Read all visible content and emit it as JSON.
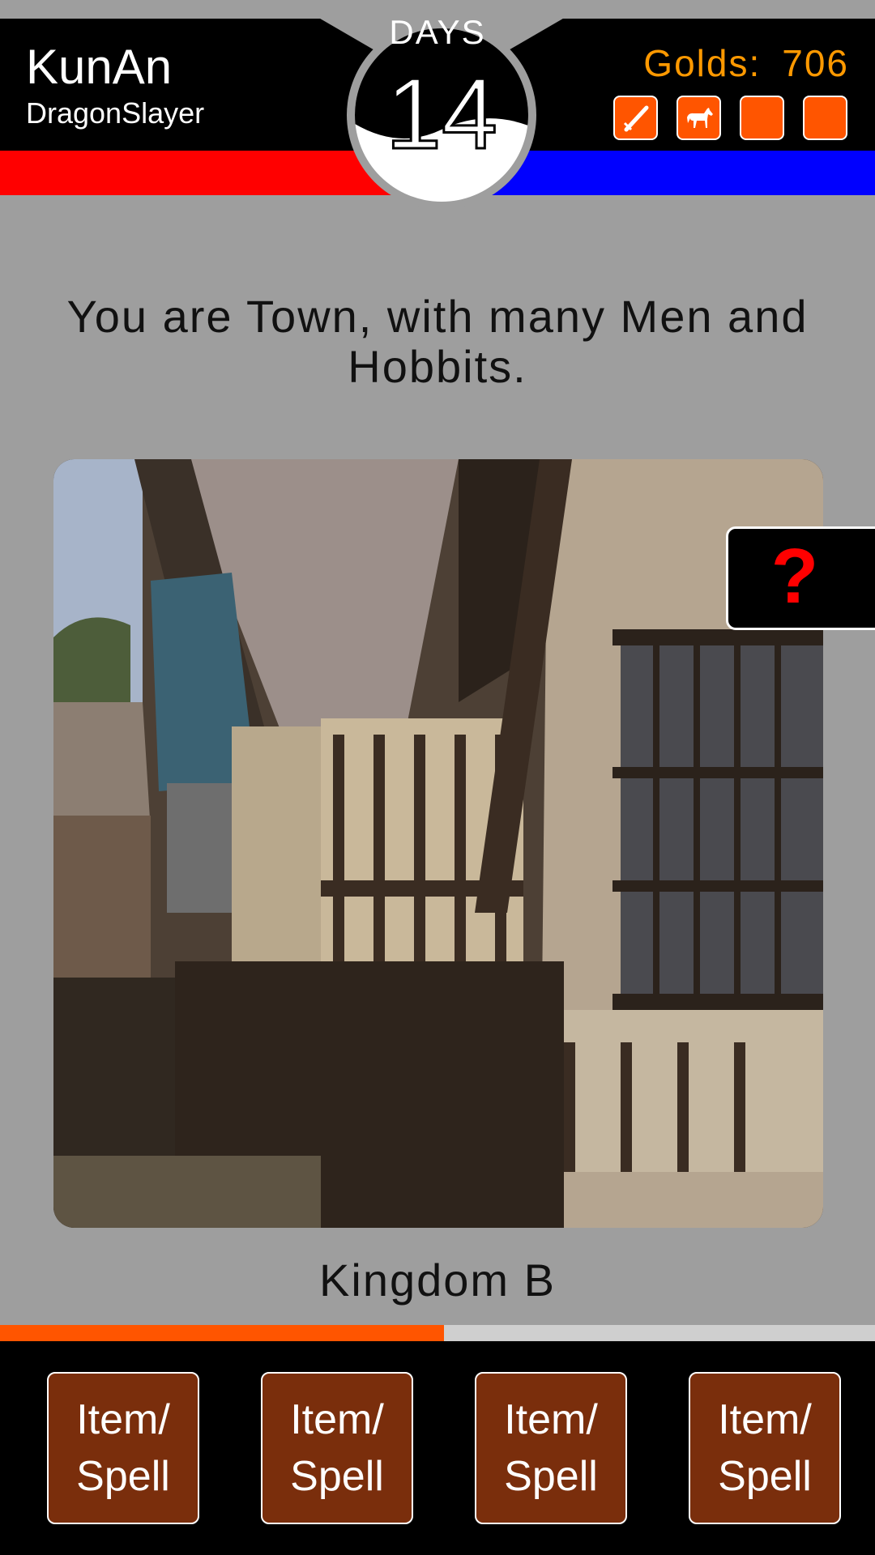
{
  "player": {
    "name": "KunAn",
    "title": "DragonSlayer"
  },
  "days": {
    "label": "DAYS",
    "count": "14"
  },
  "gold": {
    "label": "Golds:",
    "value": "706"
  },
  "slots": [
    {
      "icon": "sword-icon"
    },
    {
      "icon": "horse-icon"
    },
    {
      "icon": "empty-slot"
    },
    {
      "icon": "empty-slot"
    }
  ],
  "message": "You are Town, with many Men and Hobbits.",
  "help_label": "?",
  "location": "Kingdom B",
  "progress": {
    "fraction": 0.507
  },
  "actions": [
    {
      "label": "Item/\nSpell"
    },
    {
      "label": "Item/\nSpell"
    },
    {
      "label": "Item/\nSpell"
    },
    {
      "label": "Item/\nSpell"
    }
  ],
  "colors": {
    "accent_orange": "#ff5500",
    "gold_text": "#ff9900",
    "player_one_bar": "#ff0000",
    "player_two_bar": "#0000ff",
    "action_button": "#7a2e0c",
    "help_mark": "#ff0000"
  }
}
